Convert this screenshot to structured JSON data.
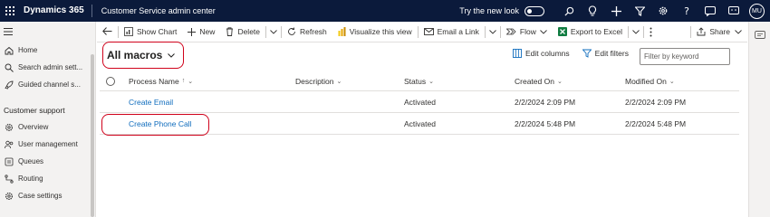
{
  "topbar": {
    "brand": "Dynamics 365",
    "app_name": "Customer Service admin center",
    "try_new_look": "Try the new look",
    "new_look_enabled": false,
    "avatar_initials": "MU",
    "bg_color": "#0b1a3b"
  },
  "sidebar": {
    "items": [
      {
        "label": "Home",
        "icon": "home-icon"
      },
      {
        "label": "Search admin sett...",
        "icon": "search-icon"
      },
      {
        "label": "Guided channel s...",
        "icon": "rocket-icon"
      }
    ],
    "group_label": "Customer support",
    "group_items": [
      {
        "label": "Overview",
        "icon": "gear-icon"
      },
      {
        "label": "User management",
        "icon": "users-icon"
      },
      {
        "label": "Queues",
        "icon": "queue-icon"
      },
      {
        "label": "Routing",
        "icon": "routing-icon"
      },
      {
        "label": "Case settings",
        "icon": "gear-icon"
      }
    ]
  },
  "command_bar": {
    "show_chart": "Show Chart",
    "new": "New",
    "delete": "Delete",
    "refresh": "Refresh",
    "visualize": "Visualize this view",
    "email_link": "Email a Link",
    "flow": "Flow",
    "export_excel": "Export to Excel",
    "share": "Share"
  },
  "view": {
    "title": "All macros",
    "edit_columns": "Edit columns",
    "edit_filters": "Edit filters",
    "keyword_placeholder": "Filter by keyword"
  },
  "grid": {
    "columns": [
      "Process Name",
      "Description",
      "Status",
      "Created On",
      "Modified On"
    ],
    "sort_indicator": "↑",
    "rows": [
      {
        "process_name": "Create Email",
        "description": "",
        "status": "Activated",
        "created_on": "2/2/2024 2:09 PM",
        "modified_on": "2/2/2024 2:09 PM"
      },
      {
        "process_name": "Create Phone Call",
        "description": "",
        "status": "Activated",
        "created_on": "2/2/2024 5:48 PM",
        "modified_on": "2/2/2024 5:48 PM"
      }
    ]
  },
  "colors": {
    "link": "#0f6cbd",
    "highlight": "#d0021b"
  }
}
